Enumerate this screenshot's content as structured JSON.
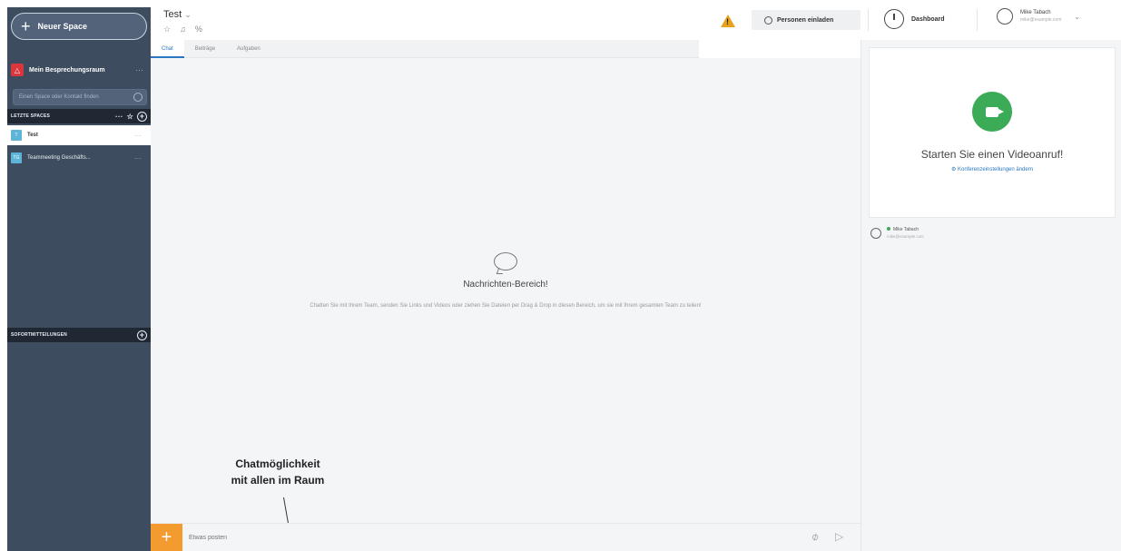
{
  "sidebar": {
    "new_space_label": "Neuer Space",
    "meeting_room_label": "Mein Besprechungsraum",
    "search_placeholder": "Einen Space oder Kontakt finden",
    "recent_spaces_label": "LETZTE SPACES",
    "recent_spaces": [
      {
        "initial": "T",
        "name": "Test",
        "active": true
      },
      {
        "initial": "TG",
        "name": "Teammeeting Geschäfts...",
        "active": false
      }
    ],
    "screen_share_label": "SOFORTMITTEILUNGEN"
  },
  "header": {
    "space_title": "Test",
    "invite_label": "Personen einladen",
    "dashboard_label": "Dashboard",
    "user_name": "Mike Tabach",
    "user_email": "mike@example.com"
  },
  "tabs": [
    {
      "label": "Chat",
      "active": true
    },
    {
      "label": "Beiträge",
      "active": false
    },
    {
      "label": "Aufgaben",
      "active": false
    }
  ],
  "chat": {
    "empty_title": "Nachrichten-Bereich!",
    "empty_desc": "Chatten Sie mit Ihrem Team, senden Sie Links und Videos oder ziehen Sie Dateien per Drag & Drop in diesen Bereich, um sie mit Ihrem gesamten Team zu teilen!",
    "input_placeholder": "Etwas posten"
  },
  "annotation": {
    "line1": "Chatmöglichkeit",
    "line2": "mit allen im Raum"
  },
  "video": {
    "title": "Starten Sie einen Videoanruf!",
    "settings_link": "Konferenzeinstellungen ändern"
  },
  "member": {
    "name": "Mike Tabach",
    "email": "mike@example.com"
  },
  "colors": {
    "sidebar_bg": "#3d4c5e",
    "accent_blue": "#2b77c2",
    "video_green": "#3bab57",
    "add_orange": "#f39b2e",
    "warning_yellow": "#e7a11b"
  }
}
